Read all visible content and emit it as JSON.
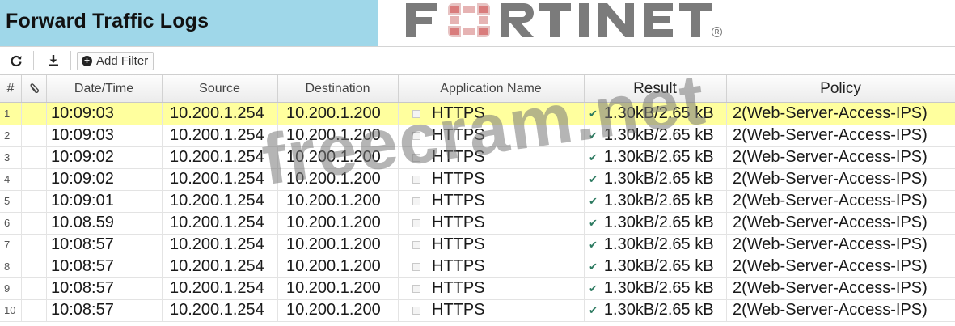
{
  "header": {
    "title": "Forward Traffic Logs",
    "logo_text": "FORTINET",
    "logo_registered": "R"
  },
  "toolbar": {
    "refresh_icon": "refresh-icon",
    "download_icon": "download-icon",
    "add_filter_label": "Add Filter"
  },
  "table": {
    "columns": [
      "#",
      "",
      "Date/Time",
      "Source",
      "Destination",
      "Application Name",
      "Result",
      "Policy"
    ],
    "rows": [
      {
        "n": "1",
        "time": "10:09:03",
        "src": "10.200.1.254",
        "dst": "10.200.1.200",
        "app": "HTTPS",
        "result": "1.30kB/2.65 kB",
        "policy": "2(Web-Server-Access-IPS)"
      },
      {
        "n": "2",
        "time": "10:09:03",
        "src": "10.200.1.254",
        "dst": "10.200.1.200",
        "app": "HTTPS",
        "result": "1.30kB/2.65 kB",
        "policy": "2(Web-Server-Access-IPS)"
      },
      {
        "n": "3",
        "time": "10:09:02",
        "src": "10.200.1.254",
        "dst": "10.200.1.200",
        "app": "HTTPS",
        "result": "1.30kB/2.65 kB",
        "policy": "2(Web-Server-Access-IPS)"
      },
      {
        "n": "4",
        "time": "10:09:02",
        "src": "10.200.1.254",
        "dst": "10.200.1.200",
        "app": "HTTPS",
        "result": "1.30kB/2.65 kB",
        "policy": "2(Web-Server-Access-IPS)"
      },
      {
        "n": "5",
        "time": "10:09:01",
        "src": "10.200.1.254",
        "dst": "10.200.1.200",
        "app": "HTTPS",
        "result": "1.30kB/2.65 kB",
        "policy": "2(Web-Server-Access-IPS)"
      },
      {
        "n": "6",
        "time": "10.08.59",
        "src": "10.200.1.254",
        "dst": "10.200.1.200",
        "app": "HTTPS",
        "result": "1.30kB/2.65 kB",
        "policy": "2(Web-Server-Access-IPS)"
      },
      {
        "n": "7",
        "time": "10:08:57",
        "src": "10.200.1.254",
        "dst": "10.200.1.200",
        "app": "HTTPS",
        "result": "1.30kB/2.65 kB",
        "policy": "2(Web-Server-Access-IPS)"
      },
      {
        "n": "8",
        "time": "10:08:57",
        "src": "10.200.1.254",
        "dst": "10.200.1.200",
        "app": "HTTPS",
        "result": "1.30kB/2.65 kB",
        "policy": "2(Web-Server-Access-IPS)"
      },
      {
        "n": "9",
        "time": "10:08:57",
        "src": "10.200.1.254",
        "dst": "10.200.1.200",
        "app": "HTTPS",
        "result": "1.30kB/2.65 kB",
        "policy": "2(Web-Server-Access-IPS)"
      },
      {
        "n": "10",
        "time": "10:08:57",
        "src": "10.200.1.254",
        "dst": "10.200.1.200",
        "app": "HTTPS",
        "result": "1.30kB/2.65 kB",
        "policy": "2(Web-Server-Access-IPS)"
      }
    ],
    "selected_row_color": "#ffff9e"
  },
  "watermark": "freecram.net",
  "colors": {
    "title_bar": "#9fd7e9",
    "logo": "#7b7b7b",
    "logo_accent": "#d97c7c",
    "check": "#2c7a60"
  }
}
